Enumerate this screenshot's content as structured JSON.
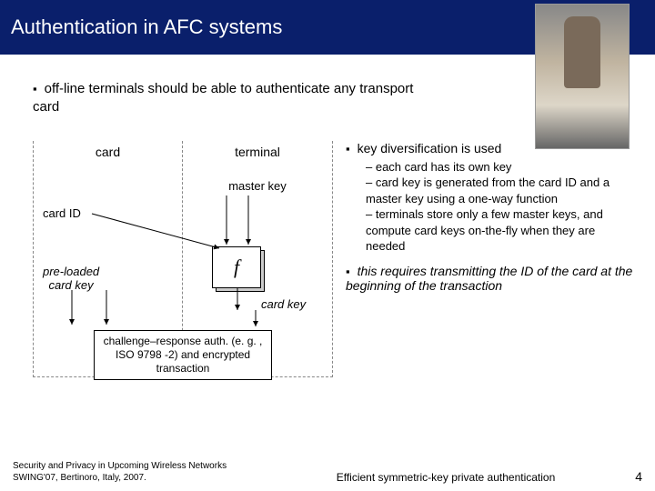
{
  "title": "Authentication in AFC systems",
  "lead": "off-line terminals should be able to authenticate any transport card",
  "diagram": {
    "col_card": "card",
    "col_terminal": "terminal",
    "master_key": "master key",
    "card_id": "card ID",
    "preloaded_l1": "pre-loaded",
    "preloaded_l2": "card key",
    "f": "f",
    "card_key": "card key",
    "challenge": "challenge–response auth. (e. g. , ISO 9798 -2) and encrypted transaction"
  },
  "right": {
    "p1": "key diversification is used",
    "subs": [
      "each card has its own key",
      "card key is generated from the card ID and a master key using a one-way function",
      "terminals store only a few master keys, and compute card keys on-the-fly when they are needed"
    ],
    "p2": "this requires transmitting the ID of the card at the beginning of the transaction"
  },
  "footer": {
    "src_l1": "Security and Privacy in Upcoming Wireless Networks",
    "src_l2": "SWING'07, Bertinoro, Italy, 2007.",
    "mid": "Efficient symmetric-key private authentication",
    "page": "4"
  }
}
